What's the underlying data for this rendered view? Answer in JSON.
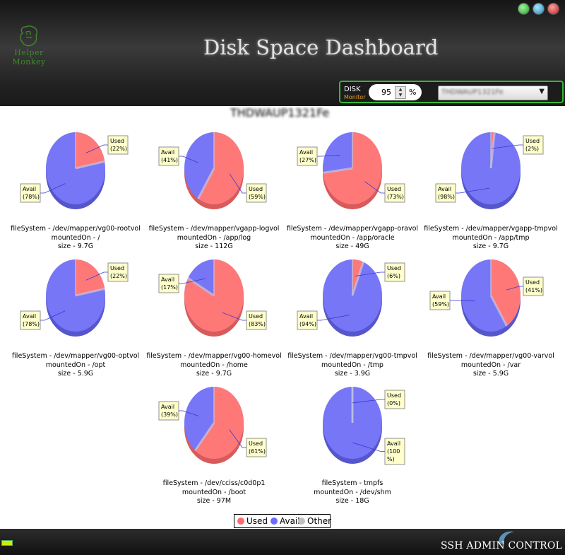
{
  "header": {
    "title": "Disk Space Dashboard",
    "logo_text_line1": "Helper",
    "logo_text_line2": "Monkey"
  },
  "window_buttons": [
    {
      "name": "green-button",
      "color": "#3bbf3b"
    },
    {
      "name": "blue-button",
      "color": "#3aa4cf"
    },
    {
      "name": "red-button",
      "color": "#d63a3a"
    }
  ],
  "monitor": {
    "label": "DISK",
    "sublabel": "Monitor",
    "threshold_value": "95",
    "threshold_unit": "%",
    "host_selected": "THDWAUP1321Fe",
    "dropdown_arrow": "▼"
  },
  "host_title": "THDWAUP1321Fe",
  "chart_data": {
    "type": "pie",
    "legend": {
      "placement": "bottom-center",
      "entries": [
        {
          "label": "Used",
          "color": "#ff6b6b"
        },
        {
          "label": "Avail",
          "color": "#6b6bff"
        },
        {
          "label": "Other",
          "color": "#c0c0c0"
        }
      ]
    },
    "charts": [
      {
        "filesystem": "fileSystem - /dev/mapper/vg00-rootvol",
        "mount": "mountedOn - /",
        "size": "size - 9.7G",
        "used": 22,
        "avail": 78,
        "used_label": "(22%)",
        "avail_label": "(78%)",
        "used_pos": "upper-right",
        "avail_pos": "lower-left"
      },
      {
        "filesystem": "fileSystem - /dev/mapper/vgapp-logvol",
        "mount": "mountedOn - /app/log",
        "size": "size - 112G",
        "used": 59,
        "avail": 41,
        "used_label": "(59%)",
        "avail_label": "(41%)",
        "used_pos": "lower-right",
        "avail_pos": "upper-left"
      },
      {
        "filesystem": "fileSystem - /dev/mapper/vgapp-oravol",
        "mount": "mountedOn - /app/oracle",
        "size": "size - 49G",
        "used": 73,
        "avail": 27,
        "used_label": "(73%)",
        "avail_label": "(27%)",
        "used_pos": "lower-right",
        "avail_pos": "upper-left"
      },
      {
        "filesystem": "fileSystem - /dev/mapper/vgapp-tmpvol",
        "mount": "mountedOn - /app/tmp",
        "size": "size - 9.7G",
        "used": 2,
        "avail": 98,
        "used_label": "(2%)",
        "avail_label": "(98%)",
        "used_pos": "upper-right",
        "avail_pos": "lower-left"
      },
      {
        "filesystem": "fileSystem - /dev/mapper/vg00-optvol",
        "mount": "mountedOn - /opt",
        "size": "size - 5.9G",
        "used": 22,
        "avail": 78,
        "used_label": "(22%)",
        "avail_label": "(78%)",
        "used_pos": "upper-right",
        "avail_pos": "lower-left"
      },
      {
        "filesystem": "fileSystem - /dev/mapper/vg00-homevol",
        "mount": "mountedOn - /home",
        "size": "size - 9.7G",
        "used": 83,
        "avail": 17,
        "used_label": "(83%)",
        "avail_label": "(17%)",
        "used_pos": "lower-right",
        "avail_pos": "upper-left"
      },
      {
        "filesystem": "fileSystem - /dev/mapper/vg00-tmpvol",
        "mount": "mountedOn - /tmp",
        "size": "size - 3.9G",
        "used": 6,
        "avail": 94,
        "used_label": "(6%)",
        "avail_label": "(94%)",
        "used_pos": "upper-right",
        "avail_pos": "lower-left"
      },
      {
        "filesystem": "fileSystem - /dev/mapper/vg00-varvol",
        "mount": "mountedOn - /var",
        "size": "size - 5.9G",
        "used": 41,
        "avail": 59,
        "used_label": "(41%)",
        "avail_label": "(59%)",
        "used_pos": "right",
        "avail_pos": "left"
      },
      {
        "filesystem": "fileSystem - /dev/cciss/c0d0p1",
        "mount": "mountedOn - /boot",
        "size": "size - 97M",
        "used": 61,
        "avail": 39,
        "used_label": "(61%)",
        "avail_label": "(39%)",
        "used_pos": "lower-right",
        "avail_pos": "upper-left"
      },
      {
        "filesystem": "fileSystem - tmpfs",
        "mount": "mountedOn - /dev/shm",
        "size": "size - 18G",
        "used": 0,
        "avail": 100,
        "used_label": "(0%)",
        "avail_label": "(100\n%)",
        "used_pos": "upper-right",
        "avail_pos": "lower-right"
      }
    ]
  },
  "footer": {
    "brand": "SSH ADMIN CONTROL"
  }
}
